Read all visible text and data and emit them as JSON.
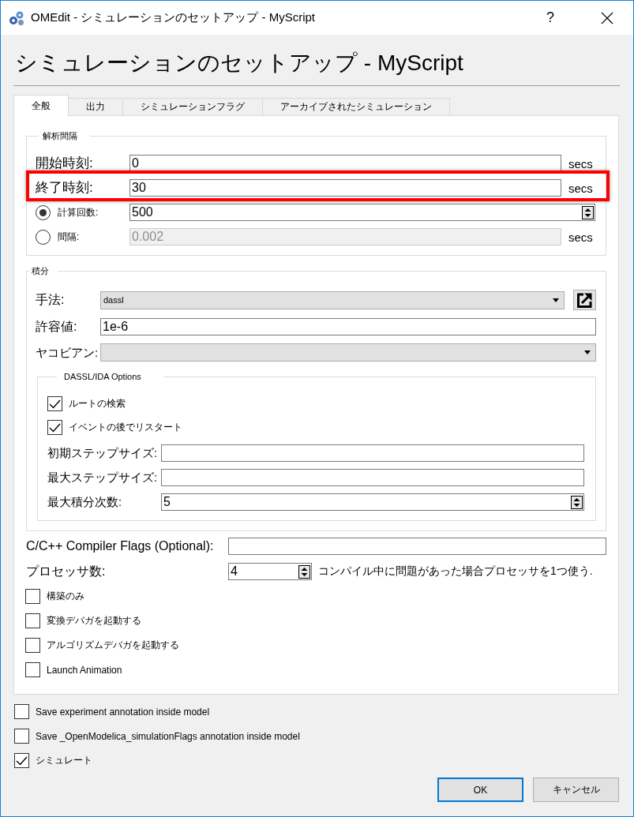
{
  "window": {
    "title": "OMEdit - シミュレーションのセットアップ - MyScript",
    "help": "?"
  },
  "heading": "シミュレーションのセットアップ - MyScript",
  "tabs": [
    {
      "label": "全般",
      "selected": true
    },
    {
      "label": "出力",
      "selected": false
    },
    {
      "label": "シミュレーションフラグ",
      "selected": false
    },
    {
      "label": "アーカイブされたシミュレーション",
      "selected": false
    }
  ],
  "interval": {
    "title": "解析間隔",
    "fields": [
      {
        "label": "開始時刻:",
        "value": "0",
        "unit": "secs",
        "highlighted": false
      },
      {
        "label": "終了時刻:",
        "value": "30",
        "unit": "secs",
        "highlighted": true
      }
    ],
    "modes": [
      {
        "kind": "spin",
        "label": "計算回数:",
        "value": "500",
        "selected": true,
        "disabled": false
      },
      {
        "kind": "field",
        "label": "間隔:",
        "value": "0.002",
        "unit": "secs",
        "selected": false,
        "disabled": true
      }
    ]
  },
  "integration": {
    "title": "積分",
    "method": {
      "label": "手法:",
      "value": "dassl"
    },
    "tolerance": {
      "label": "許容値:",
      "value": "1e-6"
    },
    "jacobian": {
      "label": "ヤコビアン:"
    },
    "options": {
      "title": "DASSL/IDA Options",
      "checks": [
        {
          "label": "ルートの検索",
          "checked": true
        },
        {
          "label": "イベントの後でリスタート",
          "checked": true
        }
      ],
      "fields": [
        {
          "kind": "field",
          "label": "初期ステップサイズ:"
        },
        {
          "kind": "field",
          "label": "最大ステップサイズ:"
        },
        {
          "kind": "spin",
          "label": "最大積分次数:",
          "value": "5"
        }
      ]
    }
  },
  "compiler_flags": {
    "label": "C/C++ Compiler Flags (Optional):"
  },
  "processors": {
    "label": "プロセッサ数:",
    "value": "4",
    "note": "コンパイル中に問題があった場合プロセッサを1つ使う."
  },
  "build_checks": [
    {
      "label": "構築のみ",
      "checked": false
    },
    {
      "label": "変換デバガを起動する",
      "checked": false
    },
    {
      "label": "アルゴリズムデバガを起動する",
      "checked": false
    },
    {
      "label": "Launch Animation",
      "checked": false
    }
  ],
  "save_checks": [
    {
      "label": "Save experiment annotation inside model",
      "checked": false
    },
    {
      "label": "Save _OpenModelica_simulationFlags annotation inside model",
      "checked": false
    },
    {
      "label": "シミュレート",
      "checked": true
    }
  ],
  "buttons": [
    {
      "label": "OK",
      "default": true
    },
    {
      "label": "キャンセル",
      "default": false
    }
  ]
}
